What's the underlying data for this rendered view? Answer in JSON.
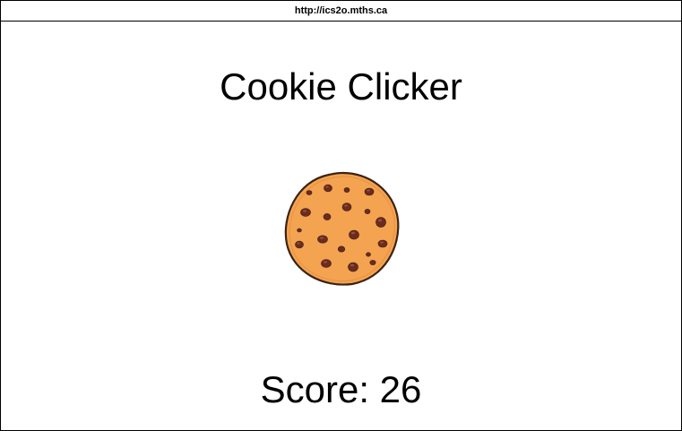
{
  "browser": {
    "url": "http://ics2o.mths.ca"
  },
  "game": {
    "title": "Cookie Clicker",
    "score_label": "Score: 26",
    "score_value": 26
  },
  "colors": {
    "cookie_dough": "#f4a350",
    "cookie_edge": "#3b2314",
    "chocolate_chip": "#6b2c1f",
    "chip_highlight": "#a85a48"
  },
  "icons": {
    "cookie": "cookie-icon"
  }
}
